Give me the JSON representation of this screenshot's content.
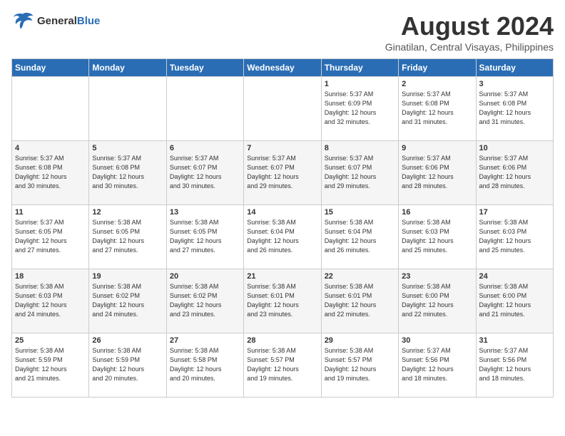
{
  "header": {
    "logo_line1": "General",
    "logo_line2": "Blue",
    "month_year": "August 2024",
    "location": "Ginatilan, Central Visayas, Philippines"
  },
  "days_of_week": [
    "Sunday",
    "Monday",
    "Tuesday",
    "Wednesday",
    "Thursday",
    "Friday",
    "Saturday"
  ],
  "weeks": [
    [
      {
        "day": "",
        "info": ""
      },
      {
        "day": "",
        "info": ""
      },
      {
        "day": "",
        "info": ""
      },
      {
        "day": "",
        "info": ""
      },
      {
        "day": "1",
        "info": "Sunrise: 5:37 AM\nSunset: 6:09 PM\nDaylight: 12 hours\nand 32 minutes."
      },
      {
        "day": "2",
        "info": "Sunrise: 5:37 AM\nSunset: 6:08 PM\nDaylight: 12 hours\nand 31 minutes."
      },
      {
        "day": "3",
        "info": "Sunrise: 5:37 AM\nSunset: 6:08 PM\nDaylight: 12 hours\nand 31 minutes."
      }
    ],
    [
      {
        "day": "4",
        "info": "Sunrise: 5:37 AM\nSunset: 6:08 PM\nDaylight: 12 hours\nand 30 minutes."
      },
      {
        "day": "5",
        "info": "Sunrise: 5:37 AM\nSunset: 6:08 PM\nDaylight: 12 hours\nand 30 minutes."
      },
      {
        "day": "6",
        "info": "Sunrise: 5:37 AM\nSunset: 6:07 PM\nDaylight: 12 hours\nand 30 minutes."
      },
      {
        "day": "7",
        "info": "Sunrise: 5:37 AM\nSunset: 6:07 PM\nDaylight: 12 hours\nand 29 minutes."
      },
      {
        "day": "8",
        "info": "Sunrise: 5:37 AM\nSunset: 6:07 PM\nDaylight: 12 hours\nand 29 minutes."
      },
      {
        "day": "9",
        "info": "Sunrise: 5:37 AM\nSunset: 6:06 PM\nDaylight: 12 hours\nand 28 minutes."
      },
      {
        "day": "10",
        "info": "Sunrise: 5:37 AM\nSunset: 6:06 PM\nDaylight: 12 hours\nand 28 minutes."
      }
    ],
    [
      {
        "day": "11",
        "info": "Sunrise: 5:37 AM\nSunset: 6:05 PM\nDaylight: 12 hours\nand 27 minutes."
      },
      {
        "day": "12",
        "info": "Sunrise: 5:38 AM\nSunset: 6:05 PM\nDaylight: 12 hours\nand 27 minutes."
      },
      {
        "day": "13",
        "info": "Sunrise: 5:38 AM\nSunset: 6:05 PM\nDaylight: 12 hours\nand 27 minutes."
      },
      {
        "day": "14",
        "info": "Sunrise: 5:38 AM\nSunset: 6:04 PM\nDaylight: 12 hours\nand 26 minutes."
      },
      {
        "day": "15",
        "info": "Sunrise: 5:38 AM\nSunset: 6:04 PM\nDaylight: 12 hours\nand 26 minutes."
      },
      {
        "day": "16",
        "info": "Sunrise: 5:38 AM\nSunset: 6:03 PM\nDaylight: 12 hours\nand 25 minutes."
      },
      {
        "day": "17",
        "info": "Sunrise: 5:38 AM\nSunset: 6:03 PM\nDaylight: 12 hours\nand 25 minutes."
      }
    ],
    [
      {
        "day": "18",
        "info": "Sunrise: 5:38 AM\nSunset: 6:03 PM\nDaylight: 12 hours\nand 24 minutes."
      },
      {
        "day": "19",
        "info": "Sunrise: 5:38 AM\nSunset: 6:02 PM\nDaylight: 12 hours\nand 24 minutes."
      },
      {
        "day": "20",
        "info": "Sunrise: 5:38 AM\nSunset: 6:02 PM\nDaylight: 12 hours\nand 23 minutes."
      },
      {
        "day": "21",
        "info": "Sunrise: 5:38 AM\nSunset: 6:01 PM\nDaylight: 12 hours\nand 23 minutes."
      },
      {
        "day": "22",
        "info": "Sunrise: 5:38 AM\nSunset: 6:01 PM\nDaylight: 12 hours\nand 22 minutes."
      },
      {
        "day": "23",
        "info": "Sunrise: 5:38 AM\nSunset: 6:00 PM\nDaylight: 12 hours\nand 22 minutes."
      },
      {
        "day": "24",
        "info": "Sunrise: 5:38 AM\nSunset: 6:00 PM\nDaylight: 12 hours\nand 21 minutes."
      }
    ],
    [
      {
        "day": "25",
        "info": "Sunrise: 5:38 AM\nSunset: 5:59 PM\nDaylight: 12 hours\nand 21 minutes."
      },
      {
        "day": "26",
        "info": "Sunrise: 5:38 AM\nSunset: 5:59 PM\nDaylight: 12 hours\nand 20 minutes."
      },
      {
        "day": "27",
        "info": "Sunrise: 5:38 AM\nSunset: 5:58 PM\nDaylight: 12 hours\nand 20 minutes."
      },
      {
        "day": "28",
        "info": "Sunrise: 5:38 AM\nSunset: 5:57 PM\nDaylight: 12 hours\nand 19 minutes."
      },
      {
        "day": "29",
        "info": "Sunrise: 5:38 AM\nSunset: 5:57 PM\nDaylight: 12 hours\nand 19 minutes."
      },
      {
        "day": "30",
        "info": "Sunrise: 5:37 AM\nSunset: 5:56 PM\nDaylight: 12 hours\nand 18 minutes."
      },
      {
        "day": "31",
        "info": "Sunrise: 5:37 AM\nSunset: 5:56 PM\nDaylight: 12 hours\nand 18 minutes."
      }
    ]
  ]
}
